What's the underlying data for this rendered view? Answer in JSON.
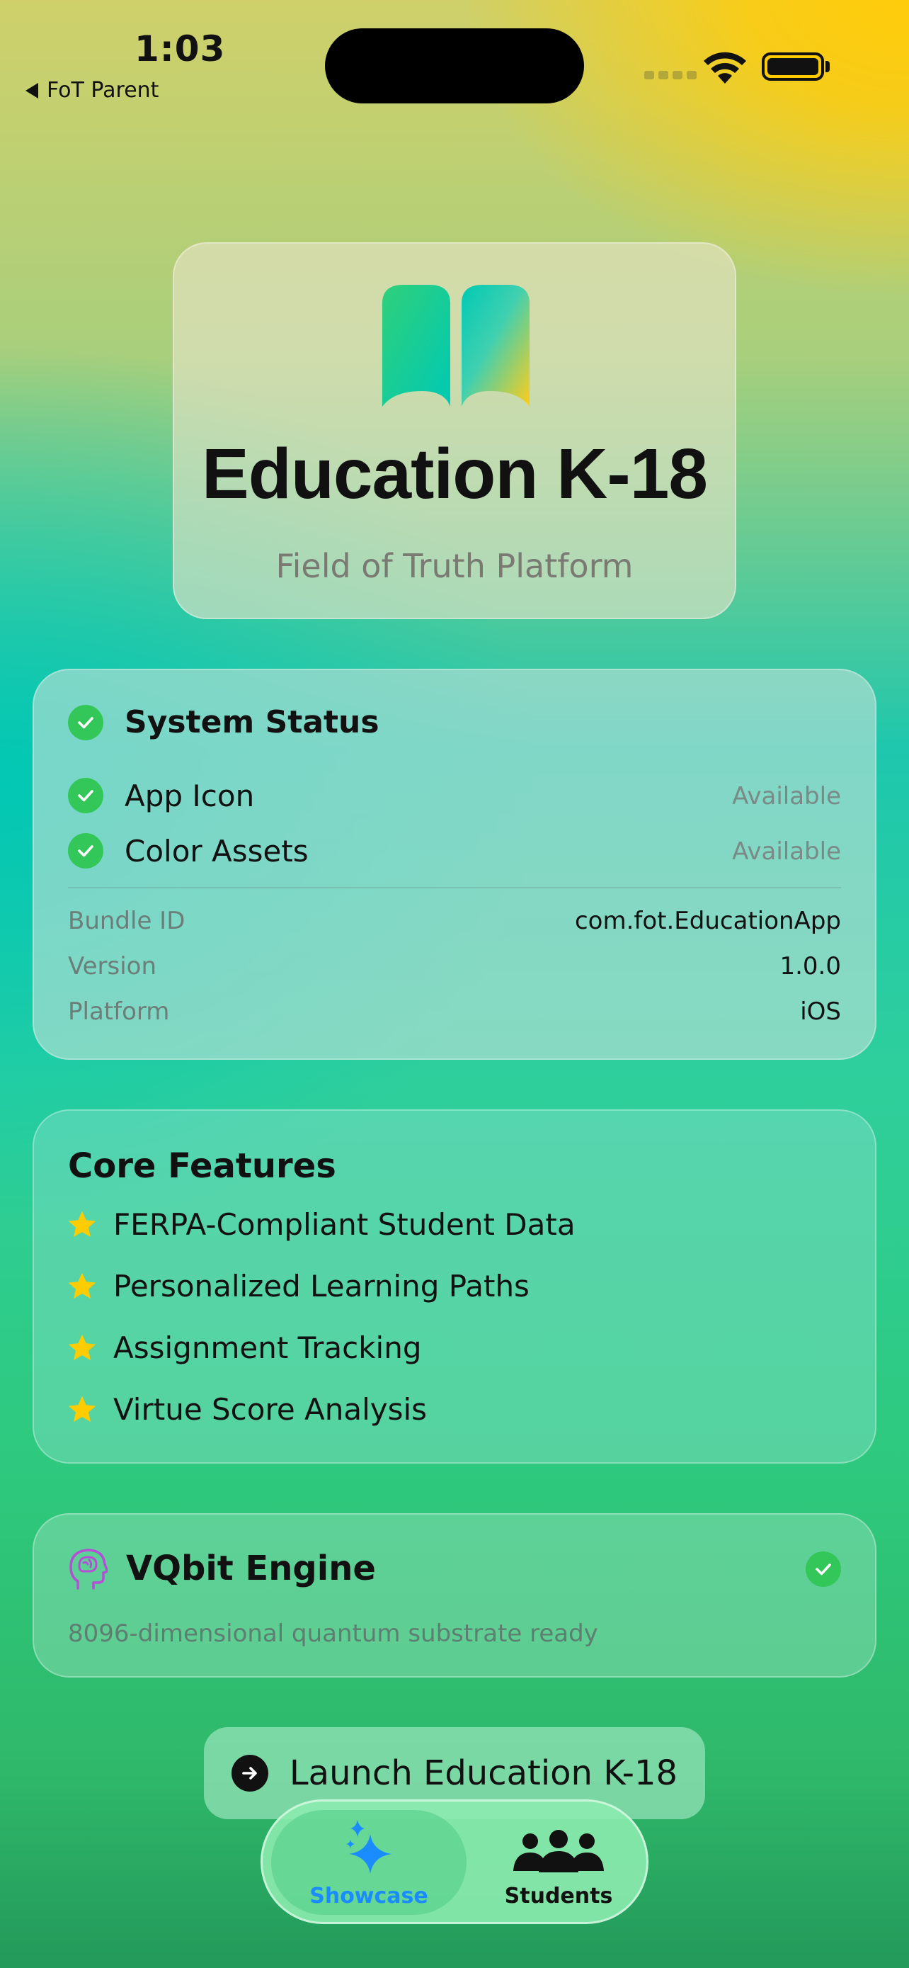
{
  "status_bar": {
    "time": "1:03",
    "back_label": "FoT Parent"
  },
  "hero": {
    "title": "Education K-18",
    "subtitle": "Field of Truth Platform",
    "icon": "book-icon"
  },
  "system_status": {
    "title": "System Status",
    "checks": [
      {
        "label": "App Icon",
        "value": "Available"
      },
      {
        "label": "Color Assets",
        "value": "Available"
      }
    ],
    "info": [
      {
        "key": "Bundle ID",
        "value": "com.fot.EducationApp"
      },
      {
        "key": "Version",
        "value": "1.0.0"
      },
      {
        "key": "Platform",
        "value": "iOS"
      }
    ]
  },
  "core_features": {
    "title": "Core Features",
    "items": [
      "FERPA-Compliant Student Data",
      "Personalized Learning Paths",
      "Assignment Tracking",
      "Virtue Score Analysis"
    ]
  },
  "vqbit": {
    "title": "VQbit Engine",
    "description": "8096-dimensional quantum substrate ready",
    "icon": "brain-head-icon"
  },
  "launch_button": {
    "label": "Launch Education K-18"
  },
  "tabbar": {
    "tabs": [
      {
        "label": "Showcase",
        "icon": "sparkles-icon",
        "active": true
      },
      {
        "label": "Students",
        "icon": "people-icon",
        "active": false
      }
    ]
  },
  "colors": {
    "check_green": "#33c759",
    "star_yellow": "#ffcc00",
    "active_tab_blue": "#1a8cff",
    "brain_purple": "#b44fd6"
  }
}
